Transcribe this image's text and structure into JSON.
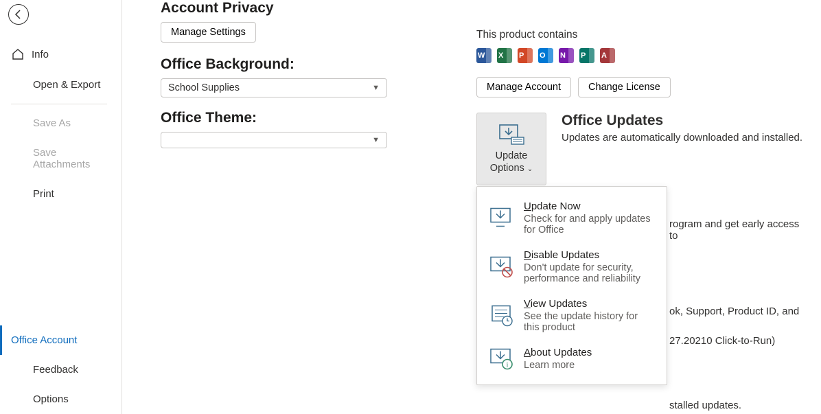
{
  "sidebar": {
    "items": [
      {
        "label": "Info"
      },
      {
        "label": "Open & Export"
      },
      {
        "label": "Save As"
      },
      {
        "label": "Save Attachments"
      },
      {
        "label": "Print"
      },
      {
        "label": "Office Account"
      },
      {
        "label": "Feedback"
      },
      {
        "label": "Options"
      }
    ]
  },
  "privacy": {
    "title": "Account Privacy",
    "button": "Manage Settings"
  },
  "background": {
    "title": "Office Background:",
    "value": "School Supplies"
  },
  "theme": {
    "title": "Office Theme:",
    "value": ""
  },
  "product": {
    "contains": "This product contains",
    "apps": [
      {
        "letter": "W",
        "color": "#2b579a"
      },
      {
        "letter": "X",
        "color": "#217346"
      },
      {
        "letter": "P",
        "color": "#d24726"
      },
      {
        "letter": "O",
        "color": "#0078d4"
      },
      {
        "letter": "N",
        "color": "#7719aa"
      },
      {
        "letter": "P",
        "color": "#077568"
      },
      {
        "letter": "A",
        "color": "#a4373a"
      }
    ],
    "manage": "Manage Account",
    "change": "Change License"
  },
  "updates": {
    "btn_label1": "Update",
    "btn_label2": "Options",
    "title": "Office Updates",
    "desc": "Updates are automatically downloaded and installed."
  },
  "menu": {
    "items": [
      {
        "title_u": "U",
        "title_rest": "pdate Now",
        "desc": "Check for and apply updates for Office",
        "icon": "download"
      },
      {
        "title_u": "D",
        "title_rest": "isable Updates",
        "desc": "Don't update for security, performance and reliability",
        "icon": "disable"
      },
      {
        "title_u": "V",
        "title_rest": "iew Updates",
        "desc": "See the update history for this product",
        "icon": "history"
      },
      {
        "title_u": "A",
        "title_rest": "bout Updates",
        "desc": "Learn more",
        "icon": "about"
      }
    ]
  },
  "bgtext": {
    "t1": "rogram and get early access to",
    "t2": "ok, Support, Product ID, and",
    "t3": "27.20210 Click-to-Run)",
    "t4": "stalled updates."
  }
}
